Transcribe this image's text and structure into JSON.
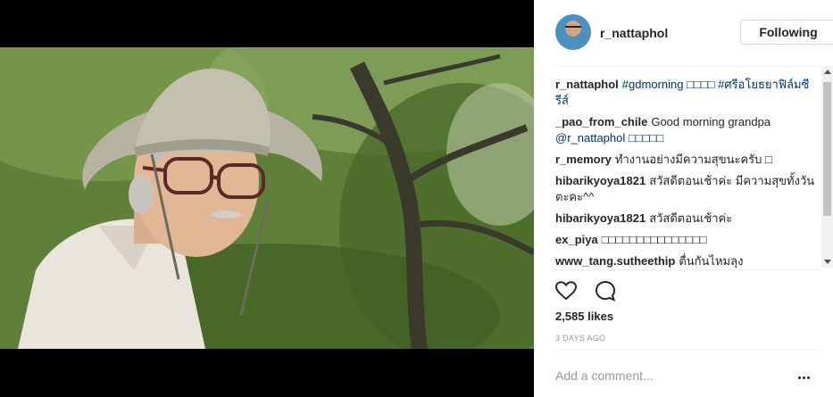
{
  "post": {
    "username": "r_nattaphol",
    "follow_label": "Following",
    "likes": "2,585 likes",
    "timestamp": "3 DAYS AGO",
    "comment_placeholder": "Add a comment..."
  },
  "comments": [
    {
      "user": "r_nattaphol",
      "text": "",
      "tags": "#gdmorning □□□□ #ศรีอโยธยาฟิล์มซีรีส์"
    },
    {
      "user": "_pao_from_chile",
      "text": "Good morning grandpa",
      "tags": "@r_nattaphol □□□□□"
    },
    {
      "user": "r_memory",
      "text": "ทำงานอย่างมีความสุขนะครับ □",
      "tags": ""
    },
    {
      "user": "hibarikyoya1821",
      "text": "สวัสดีตอนเช้าค่ะ มีความสุขทั้งวันตะคะ^^",
      "tags": ""
    },
    {
      "user": "hibarikyoya1821",
      "text": "สวัสดีตอนเช้าค่ะ",
      "tags": ""
    },
    {
      "user": "ex_piya",
      "text": "□□□□□□□□□□□□□□□",
      "tags": ""
    },
    {
      "user": "www_tang.sutheethip",
      "text": "ตื่นกันไหมลุง",
      "tags": ""
    }
  ],
  "icons": {
    "like": "heart-icon",
    "comment": "comment-bubble-icon",
    "more": "more-options-icon"
  },
  "colors": {
    "link": "#003569",
    "text": "#262626",
    "muted": "#999999",
    "divider": "#efefef"
  }
}
